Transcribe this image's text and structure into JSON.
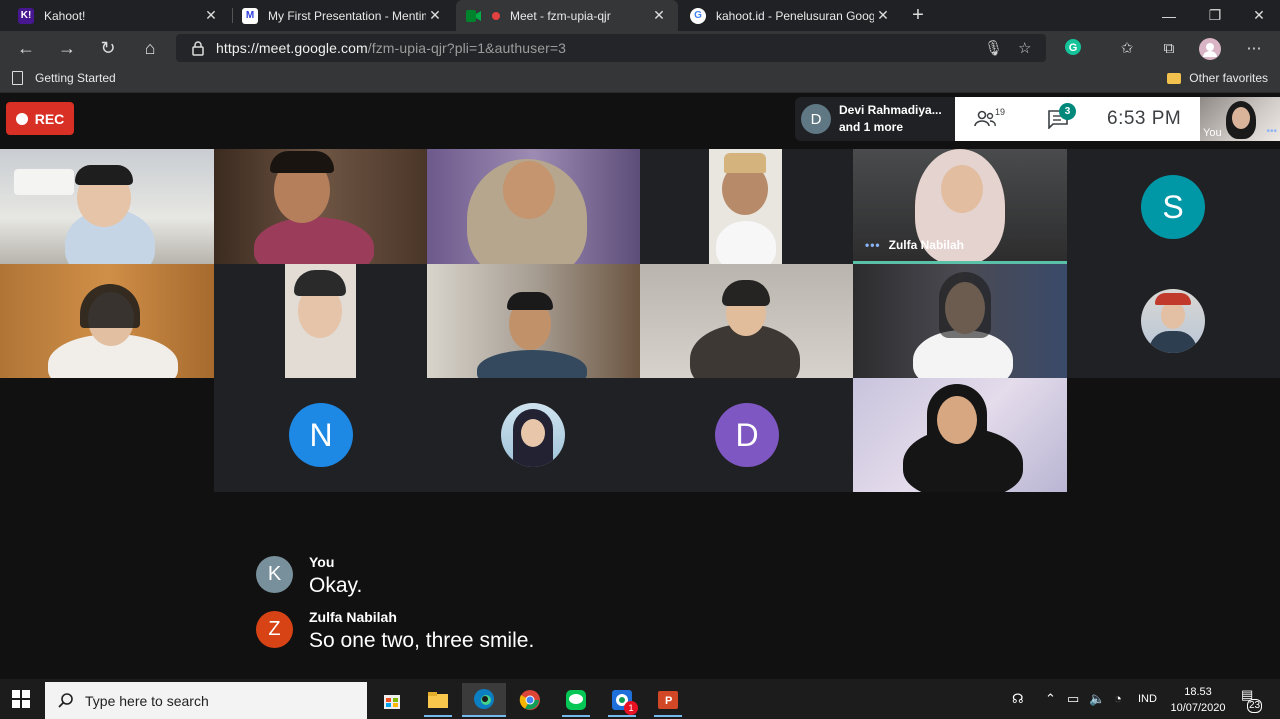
{
  "browser": {
    "tabs": [
      {
        "title": "Kahoot!",
        "icon": "kahoot-icon",
        "icon_text": "K!"
      },
      {
        "title": "My First Presentation - Mentimeter",
        "icon": "mentimeter-icon",
        "icon_text": "M"
      },
      {
        "title": "Meet - fzm-upia-qjr",
        "icon": "google-meet-icon",
        "active": true
      },
      {
        "title": "kahoot.id - Penelusuran Google",
        "icon": "google-icon",
        "icon_text": "G"
      }
    ],
    "url_host": "https://meet.google.com",
    "url_path": "/fzm-upia-qjr?pli=1&authuser=3",
    "favorites": {
      "left": "Getting Started",
      "right": "Other favorites"
    }
  },
  "meet": {
    "rec_label": "REC",
    "presenter": {
      "avatar_letter": "D",
      "line1": "Devi Rahmadiya...",
      "line2": "and 1 more"
    },
    "people_count": "19",
    "chat_badge": "3",
    "time": "6:53  PM",
    "self_label": "You",
    "tiles": [
      {
        "name": ""
      },
      {
        "name": ""
      },
      {
        "name": ""
      },
      {
        "name": ""
      },
      {
        "name": "Zulfa Nabilah"
      },
      {
        "avatar_letter": "S",
        "color": "#0097a7"
      }
    ],
    "bottom_avatars": [
      {
        "avatar_letter": "N",
        "color": "#1e88e5"
      },
      {
        "avatar_letter": "D",
        "color": "#7e57c2"
      }
    ],
    "captions": [
      {
        "avatar_letter": "K",
        "avatar_color": "#78909c",
        "speaker": "You",
        "text": "Okay."
      },
      {
        "avatar_letter": "Z",
        "avatar_color": "#d84315",
        "speaker": "Zulfa Nabilah",
        "text": "So one two, three smile."
      }
    ]
  },
  "taskbar": {
    "search_placeholder": "Type here to search",
    "lang": "IND",
    "time": "18.53",
    "date": "10/07/2020",
    "notification_count": "23",
    "chrome_badge": "1",
    "apps": [
      "store-icon",
      "file-explorer-icon",
      "edge-icon",
      "chrome-icon",
      "line-icon",
      "chrome-app-icon",
      "powerpoint-icon"
    ]
  },
  "colors": {
    "accent_teal": "#00897b",
    "rec_red": "#d93025",
    "active_speaker_border": "#5bc0a8"
  }
}
